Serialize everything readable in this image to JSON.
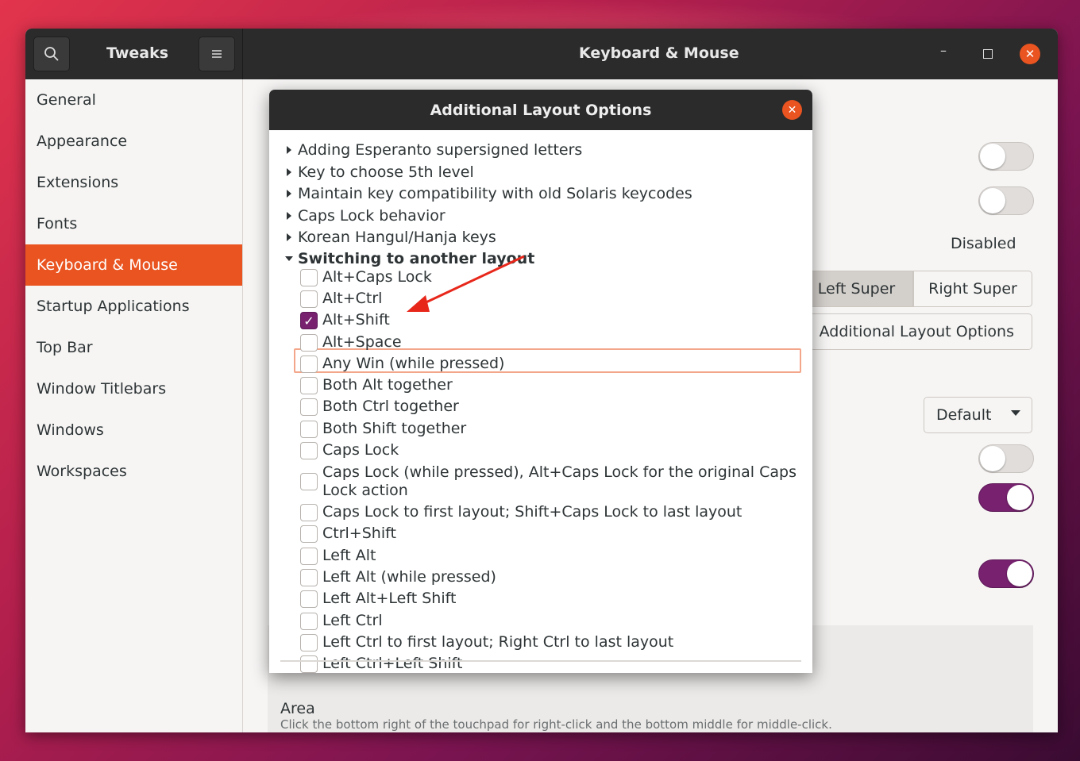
{
  "headerbar": {
    "app_title": "Tweaks",
    "window_title": "Keyboard & Mouse",
    "search_icon": "search-icon",
    "menu_icon": "hamburger-menu-icon",
    "minimize_glyph": "–",
    "close_glyph": "✕"
  },
  "sidebar": {
    "items": [
      {
        "label": "General"
      },
      {
        "label": "Appearance"
      },
      {
        "label": "Extensions"
      },
      {
        "label": "Fonts"
      },
      {
        "label": "Keyboard & Mouse",
        "active": true
      },
      {
        "label": "Startup Applications"
      },
      {
        "label": "Top Bar"
      },
      {
        "label": "Window Titlebars"
      },
      {
        "label": "Windows"
      },
      {
        "label": "Workspaces"
      }
    ]
  },
  "main": {
    "disabled_label": "Disabled",
    "left_super": "Left Super",
    "right_super": "Right Super",
    "additional_layout_options": "Additional Layout Options",
    "default_combo": "Default",
    "area_title": "Area",
    "area_desc": "Click the bottom right of the touchpad for right-click and the bottom middle for middle-click.",
    "switches": [
      {
        "state": "off"
      },
      {
        "state": "off"
      },
      {
        "state": "off"
      },
      {
        "state": "on"
      },
      {
        "state": "on"
      }
    ]
  },
  "dialog": {
    "title": "Additional Layout Options",
    "close_glyph": "✕",
    "groups": [
      {
        "label": "Adding Esperanto supersigned letters",
        "expanded": false
      },
      {
        "label": "Key to choose 5th level",
        "expanded": false
      },
      {
        "label": "Maintain key compatibility with old Solaris keycodes",
        "expanded": false
      },
      {
        "label": "Caps Lock behavior",
        "expanded": false
      },
      {
        "label": "Korean Hangul/Hanja keys",
        "expanded": false
      },
      {
        "label": "Switching to another layout",
        "expanded": true
      }
    ],
    "options": [
      {
        "label": "Alt+Caps Lock",
        "checked": false
      },
      {
        "label": "Alt+Ctrl",
        "checked": false
      },
      {
        "label": "Alt+Shift",
        "checked": true
      },
      {
        "label": "Alt+Space",
        "checked": false
      },
      {
        "label": "Any Win (while pressed)",
        "checked": false
      },
      {
        "label": "Both Alt together",
        "checked": false
      },
      {
        "label": "Both Ctrl together",
        "checked": false
      },
      {
        "label": "Both Shift together",
        "checked": false
      },
      {
        "label": "Caps Lock",
        "checked": false
      },
      {
        "label": "Caps Lock (while pressed), Alt+Caps Lock for the original Caps",
        "label2": "Lock action",
        "checked": false
      },
      {
        "label": "Caps Lock to first layout; Shift+Caps Lock to last layout",
        "checked": false
      },
      {
        "label": "Ctrl+Shift",
        "checked": false
      },
      {
        "label": "Left Alt",
        "checked": false
      },
      {
        "label": "Left Alt (while pressed)",
        "checked": false
      },
      {
        "label": "Left Alt+Left Shift",
        "checked": false
      },
      {
        "label": "Left Ctrl",
        "checked": false
      },
      {
        "label": "Left Ctrl to first layout; Right Ctrl to last layout",
        "checked": false
      },
      {
        "label": "Left Ctrl+Left Shift",
        "checked": false
      }
    ]
  },
  "colors": {
    "accent": "#e95420",
    "checked": "#77216f",
    "annotation_arrow": "#e8271b"
  }
}
